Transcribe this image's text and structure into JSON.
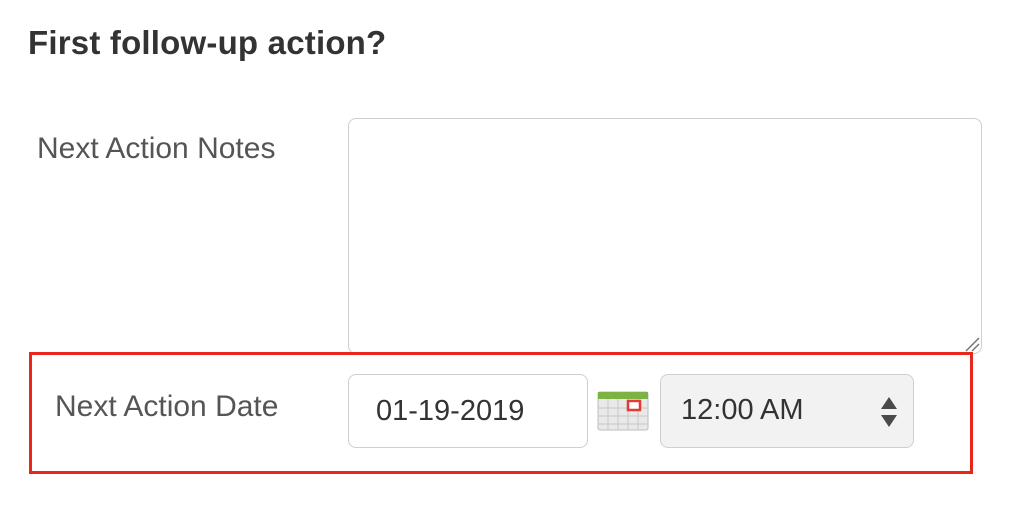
{
  "section": {
    "title": "First follow-up action?"
  },
  "notes": {
    "label": "Next Action Notes",
    "value": ""
  },
  "date": {
    "label": "Next Action Date",
    "value": "01-19-2019"
  },
  "time": {
    "value": "12:00 AM"
  },
  "icons": {
    "calendar": "calendar-icon",
    "select_arrows": "updown-arrows-icon",
    "resize": "resize-grip-icon"
  },
  "colors": {
    "highlight": "#e8261b",
    "field_border": "#cfcfcf",
    "select_bg": "#f2f2f2",
    "calendar_green": "#7cb342",
    "calendar_red": "#e53935"
  }
}
